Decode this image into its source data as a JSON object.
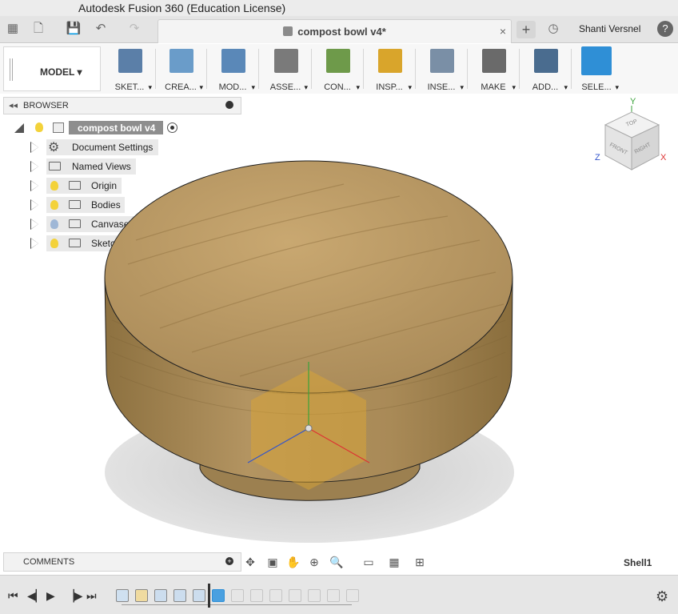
{
  "window": {
    "title": "Autodesk Fusion 360 (Education License)"
  },
  "app_bar": {
    "doc_tab_title": "compost bowl v4*",
    "close_glyph": "×",
    "new_tab_glyph": "+",
    "user_name": "Shanti Versnel",
    "help_glyph": "?"
  },
  "toolbar": {
    "workspace": "MODEL",
    "groups": [
      {
        "label": "SKET...",
        "icon": "sketch-icon",
        "color": "#5b7fa8"
      },
      {
        "label": "CREA...",
        "icon": "create-icon",
        "color": "#6a9cc9"
      },
      {
        "label": "MOD...",
        "icon": "modify-icon",
        "color": "#5a88b8"
      },
      {
        "label": "ASSE...",
        "icon": "assemble-icon",
        "color": "#7a7a7a"
      },
      {
        "label": "CON...",
        "icon": "construct-icon",
        "color": "#6e9a4a"
      },
      {
        "label": "INSP...",
        "icon": "inspect-icon",
        "color": "#d9a52b"
      },
      {
        "label": "INSE...",
        "icon": "insert-icon",
        "color": "#7a8fa6"
      },
      {
        "label": "MAKE",
        "icon": "make-icon",
        "color": "#6a6a6a"
      },
      {
        "label": "ADD...",
        "icon": "addins-icon",
        "color": "#4a6c8f"
      },
      {
        "label": "SELE...",
        "icon": "select-icon",
        "color": "#2f8fd6"
      }
    ]
  },
  "browser": {
    "title": "BROWSER",
    "root": "compost bowl v4",
    "items": [
      {
        "label": "Document Settings",
        "icon": "gear-icon"
      },
      {
        "label": "Named Views",
        "icon": "folder-icon"
      },
      {
        "label": "Origin",
        "icon": "folder-icon"
      },
      {
        "label": "Bodies",
        "icon": "folder-icon"
      },
      {
        "label": "Canvases",
        "icon": "folder-icon"
      },
      {
        "label": "Sketches",
        "icon": "folder-icon"
      }
    ]
  },
  "viewcube": {
    "top": "TOP",
    "front": "FRONT",
    "right": "RIGHT",
    "axes": {
      "y": "Y",
      "x": "X",
      "z": "Z"
    }
  },
  "comments": {
    "title": "COMMENTS"
  },
  "status": {
    "active_feature": "Shell1"
  },
  "colors": {
    "wood_top": "#b8965e",
    "wood_side": "#a88a55",
    "accent": "#2f8fd6"
  }
}
